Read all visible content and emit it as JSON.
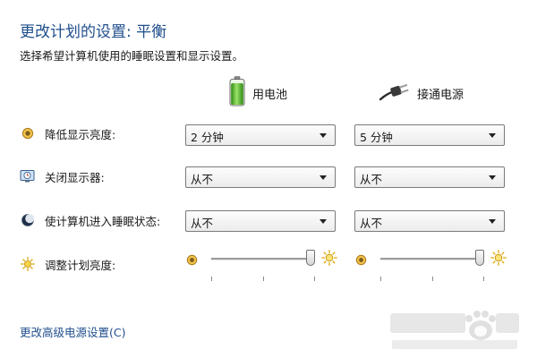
{
  "header": {
    "title": "更改计划的设置: 平衡",
    "subtitle": "选择希望计算机使用的睡眠设置和显示设置。"
  },
  "columns": {
    "battery_label": "用电池",
    "plugged_label": "接通电源"
  },
  "settings": [
    {
      "label": "降低显示亮度:",
      "icon": "sun-dim-icon",
      "battery_value": "2 分钟",
      "plugged_value": "5 分钟"
    },
    {
      "label": "关闭显示器:",
      "icon": "monitor-clock-icon",
      "battery_value": "从不",
      "plugged_value": "从不"
    },
    {
      "label": "使计算机进入睡眠状态:",
      "icon": "moon-sleep-icon",
      "battery_value": "从不",
      "plugged_value": "从不"
    }
  ],
  "brightness": {
    "label": "调整计划亮度:",
    "icon": "brightness-icon",
    "battery_level": 1.0,
    "plugged_level": 1.0
  },
  "links": {
    "advanced": "更改高级电源设置(C)"
  },
  "colors": {
    "title": "#1f4e8c",
    "link": "#1f4e8c",
    "battery_green": "#4caf2a",
    "sun_yellow": "#e0a800"
  }
}
